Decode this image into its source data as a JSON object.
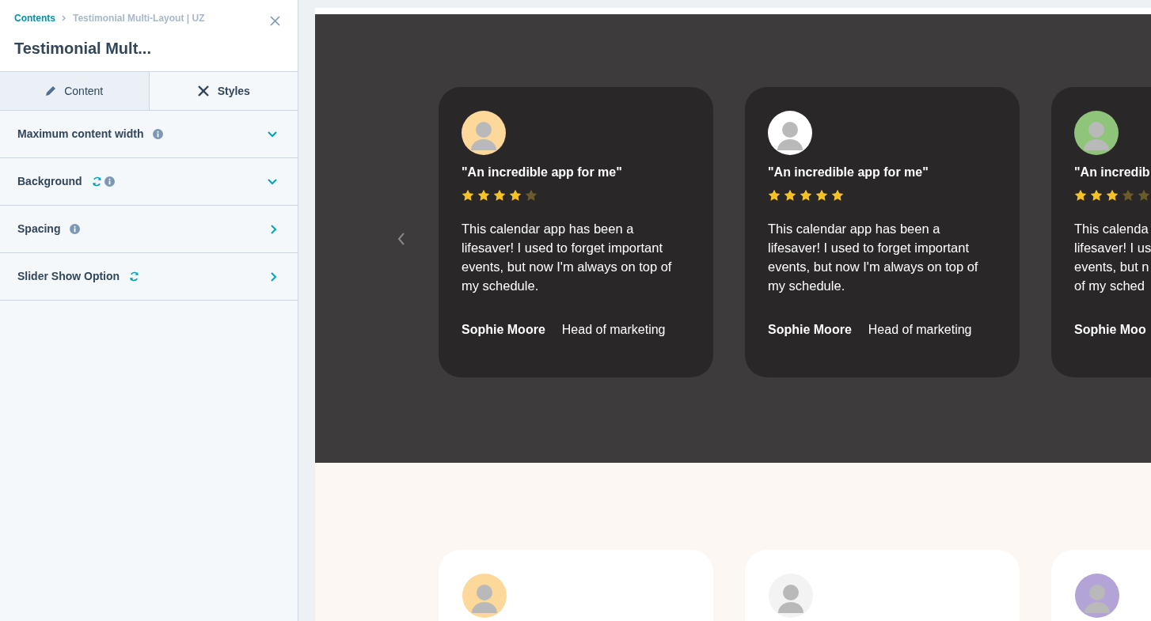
{
  "panel": {
    "breadcrumb": [
      "Contents",
      "Testimonial Multi-Layout | UZ"
    ],
    "title": "Testimonial Mult...",
    "tabs": [
      {
        "label": "Content",
        "selected": false
      },
      {
        "label": "Styles",
        "selected": true
      }
    ],
    "sections": [
      {
        "label": "Maximum content width",
        "sync": false,
        "info": true,
        "expanded": true
      },
      {
        "label": "Background",
        "sync": true,
        "info": true,
        "expanded": true
      },
      {
        "label": "Spacing",
        "sync": false,
        "info": true,
        "expanded": false
      },
      {
        "label": "Slider Show Option",
        "sync": true,
        "info": false,
        "expanded": false
      }
    ]
  },
  "preview": {
    "dark_cards": [
      {
        "title": "\"An incredible app for me\"",
        "stars": 4,
        "body": "This calendar app has been a lifesaver! I used to forget important events, but now I'm always on top of my schedule.",
        "name": "Sophie Moore",
        "role": "Head of marketing"
      },
      {
        "title": "\"An incredible app for me\"",
        "stars": 5,
        "body": "This calendar app has been a lifesaver! I used to forget important events, but now I'm always on top of my schedule.",
        "name": "Sophie Moore",
        "role": "Head of marketing"
      },
      {
        "title": "\"An incredib",
        "stars": 3,
        "body": "This calenda\nlifesaver! I us\nevents, but n\nof my sched",
        "name": "Sophie Moo"
      }
    ]
  }
}
